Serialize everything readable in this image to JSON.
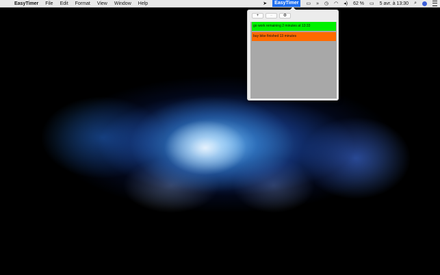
{
  "menubar": {
    "apple": "",
    "app_name": "EasyTimer",
    "menus": [
      "File",
      "Edit",
      "Format",
      "View",
      "Window",
      "Help"
    ],
    "status_item": "EasyTimer",
    "battery_percent": "62 %",
    "clock": "5 avr. à 13:30"
  },
  "popover": {
    "toolbar": {
      "add_label": "+",
      "remove_label": "−",
      "settings_label": "⚙"
    },
    "timers": [
      {
        "text": "go work remaining 2 minutes at 13:33",
        "color": "#00f100"
      },
      {
        "text": "buy bike finished 13 minutes",
        "color": "#ff6a00"
      }
    ]
  },
  "colors": {
    "list_background": "#a8a8a8",
    "status_highlight": "#1f6ff0"
  }
}
